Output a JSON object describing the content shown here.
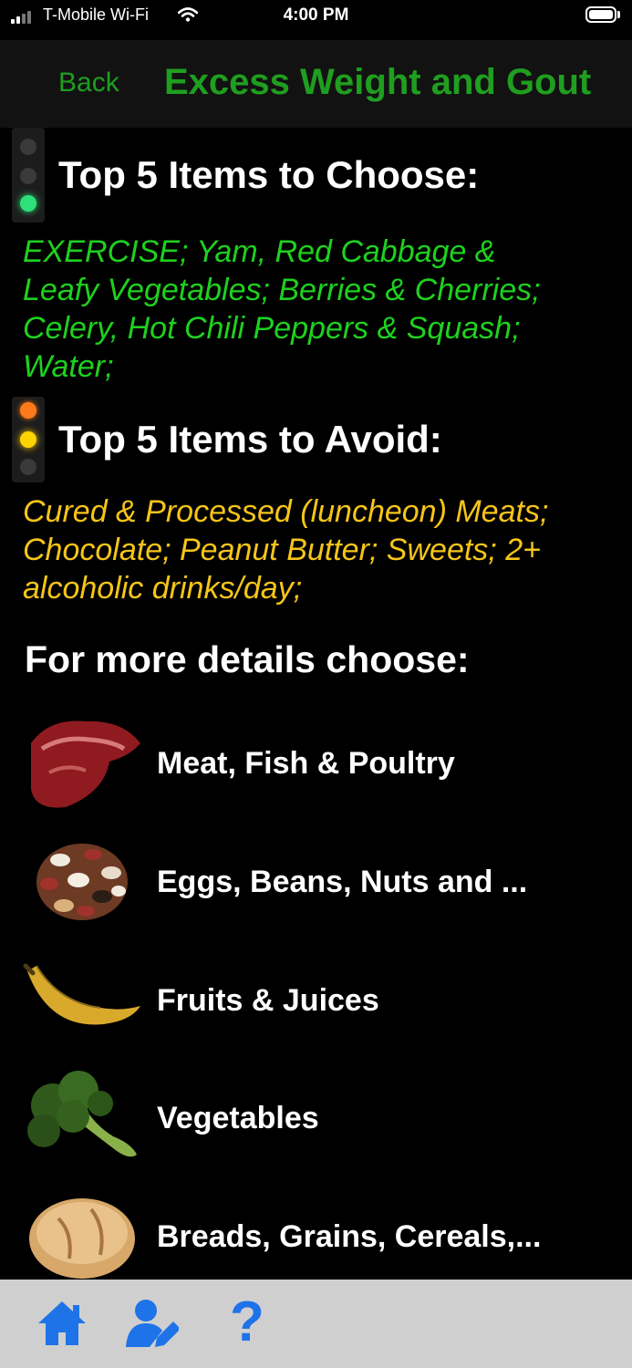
{
  "status_bar": {
    "carrier": "T-Mobile Wi-Fi",
    "time": "4:00 PM"
  },
  "nav": {
    "back_label": "Back",
    "title": "Excess Weight and Gout"
  },
  "choose": {
    "heading": "Top 5 Items to Choose:",
    "lines": [
      "EXERCISE; Yam, Red Cabbage &",
      "Leafy Vegetables; Berries & Cherries;",
      "Celery, Hot Chili Peppers & Squash;",
      "Water;"
    ]
  },
  "avoid": {
    "heading": "Top 5 Items to Avoid:",
    "lines": [
      "Cured & Processed (luncheon) Meats;",
      "Chocolate; Peanut Butter; Sweets; 2+",
      "alcoholic drinks/day;"
    ]
  },
  "details": {
    "heading": "For more details choose:",
    "items": [
      {
        "label": "Meat, Fish & Poultry",
        "icon": "steak-icon"
      },
      {
        "label": "Eggs, Beans, Nuts and ...",
        "icon": "beans-icon"
      },
      {
        "label": "Fruits & Juices",
        "icon": "banana-icon"
      },
      {
        "label": "Vegetables",
        "icon": "broccoli-icon"
      },
      {
        "label": "Breads, Grains, Cereals,...",
        "icon": "bread-icon"
      }
    ]
  },
  "tab_bar": {
    "help_label": "?",
    "icons": [
      "home-icon",
      "user-edit-icon",
      "help-icon"
    ]
  },
  "colors": {
    "nav_green": "#1f9e1f",
    "choose_green": "#1ed11e",
    "avoid_yellow": "#f5c518",
    "tab_blue": "#1e73e8",
    "tab_bar_bg": "#cfcfcf"
  }
}
